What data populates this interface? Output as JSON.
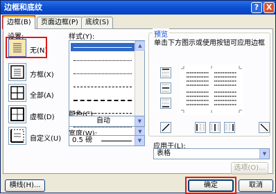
{
  "window": {
    "title": "边框和底纹",
    "help_label": "?",
    "close_label": "X"
  },
  "tabs": [
    {
      "label": "边框(B)"
    },
    {
      "label": "页面边框(P)"
    },
    {
      "label": "底纹(S)"
    }
  ],
  "settings": {
    "label": "设置:",
    "items": [
      {
        "label": "无(N)"
      },
      {
        "label": "方框(X)"
      },
      {
        "label": "全部(A)"
      },
      {
        "label": "虚框(D)"
      },
      {
        "label": "自定义(U)"
      }
    ]
  },
  "style": {
    "label": "样式(Y):"
  },
  "color": {
    "label": "颜色(C):",
    "value": "自动"
  },
  "width": {
    "label": "宽度(W):",
    "value": "0.5 磅"
  },
  "preview": {
    "title": "预览",
    "hint": "单击下方图示或使用按钮可应用边框"
  },
  "apply": {
    "label": "应用于(L):",
    "value": "表格",
    "options_button": "选项(O)..."
  },
  "footer": {
    "toolbar_button": "横线(H)...",
    "ok_button": "确定",
    "cancel_button": "取消"
  },
  "colors": {
    "title_bar": "#0a4fd1",
    "highlight": "#e01818",
    "accent_tab": "#f9b13a"
  }
}
